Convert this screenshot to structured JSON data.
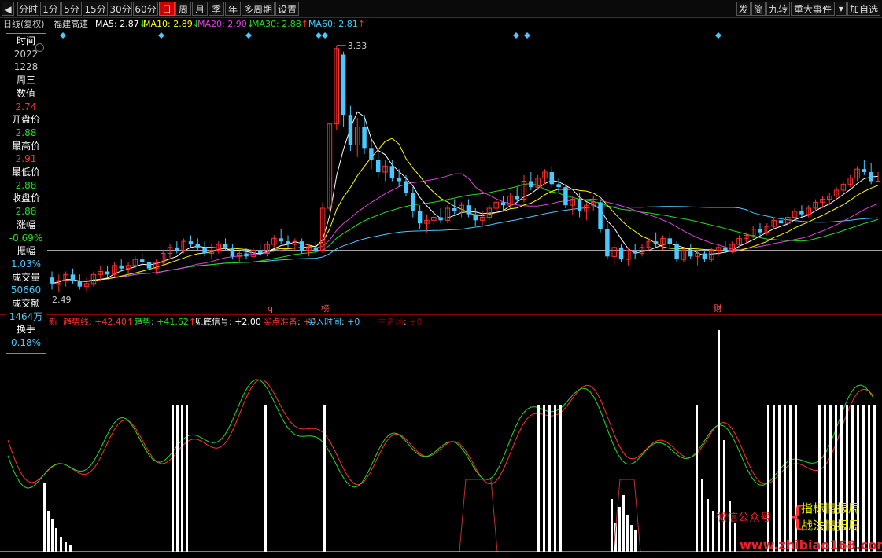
{
  "toolbar": {
    "tabs": [
      "分时",
      "1分",
      "5分",
      "15分",
      "30分",
      "60分",
      "日",
      "周",
      "月",
      "季",
      "年",
      "多周期",
      "设置"
    ],
    "active_tab": "日",
    "right_buttons": [
      "发",
      "简",
      "九转",
      "重大事件",
      "加自选"
    ]
  },
  "info": {
    "period_label": "日线(复权)",
    "stock_name": "福建高速",
    "ma": [
      {
        "label": "MA5: 2.87",
        "arrow": "↓",
        "color": "#ffffff"
      },
      {
        "label": "MA10: 2.89",
        "arrow": "↓",
        "color": "#ffff00"
      },
      {
        "label": "MA20: 2.90",
        "arrow": "↓",
        "color": "#e040e0"
      },
      {
        "label": "MA30: 2.88",
        "arrow": "↑",
        "color": "#22dd22"
      },
      {
        "label": "MA60: 2.81",
        "arrow": "↑",
        "color": "#4ac8ff"
      }
    ]
  },
  "data_panel": [
    {
      "text": "时间",
      "color": "#ffffff"
    },
    {
      "text": "2022",
      "color": "#cccccc"
    },
    {
      "text": "1228",
      "color": "#cccccc"
    },
    {
      "text": "周三",
      "color": "#ffffff"
    },
    {
      "text": "数值",
      "color": "#ffffff"
    },
    {
      "text": "2.74",
      "color": "#ff3030"
    },
    {
      "text": "开盘价",
      "color": "#ffffff"
    },
    {
      "text": "2.88",
      "color": "#22dd22"
    },
    {
      "text": "最高价",
      "color": "#ffffff"
    },
    {
      "text": "2.91",
      "color": "#ff3030"
    },
    {
      "text": "最低价",
      "color": "#ffffff"
    },
    {
      "text": "2.88",
      "color": "#22dd22"
    },
    {
      "text": "收盘价",
      "color": "#ffffff"
    },
    {
      "text": "2.88",
      "color": "#22dd22"
    },
    {
      "text": "涨幅",
      "color": "#ffffff"
    },
    {
      "text": "-0.69%",
      "color": "#22dd22"
    },
    {
      "text": "振幅",
      "color": "#ffffff"
    },
    {
      "text": "1.03%",
      "color": "#4ac8ff"
    },
    {
      "text": "成交量",
      "color": "#ffffff"
    },
    {
      "text": "50660",
      "color": "#4ac8ff"
    },
    {
      "text": "成交额",
      "color": "#ffffff"
    },
    {
      "text": "1464万",
      "color": "#4ac8ff"
    },
    {
      "text": "换手",
      "color": "#ffffff"
    },
    {
      "text": "0.18%",
      "color": "#4ac8ff"
    }
  ],
  "indicator": {
    "name": "新",
    "items": [
      {
        "label": "趋势线",
        "value": "+42.40",
        "arrow": "↑",
        "color": "#ff3030"
      },
      {
        "label": "趋势",
        "value": "+41.62",
        "arrow": "↑",
        "color": "#22dd22"
      },
      {
        "label": "见底信号",
        "value": "+2.00",
        "arrow": "",
        "color": "#ffffff"
      },
      {
        "label": "买点准备",
        "value": "+0",
        "arrow": "",
        "color": "#ff3030"
      },
      {
        "label": "买入时间",
        "value": "+0",
        "arrow": "",
        "color": "#4ac8ff"
      },
      {
        "label": "主进场",
        "value": "+0",
        "arrow": "",
        "color": "#8b0000"
      }
    ]
  },
  "watermark": {
    "wechat": "微信公众号",
    "brace": "{",
    "line1": "指标情报局",
    "line2": "战法情报局",
    "url": "www.zhibiao168.com"
  },
  "chart_data": {
    "type": "candlestick",
    "price_high_label": "3.33",
    "price_low_label": "2.49",
    "reference_price": 2.65,
    "event_markers": [
      "q",
      "榜",
      "财"
    ],
    "colors": {
      "up": "#ff3030",
      "down": "#4ac8ff",
      "ma5": "#ffffff",
      "ma10": "#ffff00",
      "ma20": "#e040e0",
      "ma30": "#22dd22",
      "ma60": "#4ac8ff"
    },
    "candles": [
      {
        "o": 2.56,
        "h": 2.58,
        "l": 2.52,
        "c": 2.54
      },
      {
        "o": 2.54,
        "h": 2.57,
        "l": 2.51,
        "c": 2.55
      },
      {
        "o": 2.55,
        "h": 2.58,
        "l": 2.53,
        "c": 2.57
      },
      {
        "o": 2.57,
        "h": 2.59,
        "l": 2.54,
        "c": 2.55
      },
      {
        "o": 2.55,
        "h": 2.57,
        "l": 2.52,
        "c": 2.53
      },
      {
        "o": 2.53,
        "h": 2.56,
        "l": 2.51,
        "c": 2.54
      },
      {
        "o": 2.54,
        "h": 2.58,
        "l": 2.53,
        "c": 2.57
      },
      {
        "o": 2.57,
        "h": 2.6,
        "l": 2.55,
        "c": 2.58
      },
      {
        "o": 2.58,
        "h": 2.6,
        "l": 2.56,
        "c": 2.57
      },
      {
        "o": 2.57,
        "h": 2.61,
        "l": 2.56,
        "c": 2.6
      },
      {
        "o": 2.6,
        "h": 2.62,
        "l": 2.58,
        "c": 2.59
      },
      {
        "o": 2.59,
        "h": 2.61,
        "l": 2.57,
        "c": 2.6
      },
      {
        "o": 2.6,
        "h": 2.63,
        "l": 2.59,
        "c": 2.62
      },
      {
        "o": 2.62,
        "h": 2.64,
        "l": 2.6,
        "c": 2.61
      },
      {
        "o": 2.61,
        "h": 2.63,
        "l": 2.58,
        "c": 2.59
      },
      {
        "o": 2.59,
        "h": 2.62,
        "l": 2.57,
        "c": 2.61
      },
      {
        "o": 2.61,
        "h": 2.65,
        "l": 2.6,
        "c": 2.64
      },
      {
        "o": 2.64,
        "h": 2.67,
        "l": 2.62,
        "c": 2.66
      },
      {
        "o": 2.66,
        "h": 2.68,
        "l": 2.64,
        "c": 2.65
      },
      {
        "o": 2.65,
        "h": 2.69,
        "l": 2.64,
        "c": 2.68
      },
      {
        "o": 2.68,
        "h": 2.7,
        "l": 2.66,
        "c": 2.67
      },
      {
        "o": 2.67,
        "h": 2.69,
        "l": 2.65,
        "c": 2.66
      },
      {
        "o": 2.66,
        "h": 2.68,
        "l": 2.63,
        "c": 2.64
      },
      {
        "o": 2.64,
        "h": 2.67,
        "l": 2.62,
        "c": 2.65
      },
      {
        "o": 2.65,
        "h": 2.68,
        "l": 2.64,
        "c": 2.67
      },
      {
        "o": 2.67,
        "h": 2.69,
        "l": 2.65,
        "c": 2.66
      },
      {
        "o": 2.66,
        "h": 2.67,
        "l": 2.62,
        "c": 2.63
      },
      {
        "o": 2.63,
        "h": 2.65,
        "l": 2.61,
        "c": 2.64
      },
      {
        "o": 2.64,
        "h": 2.66,
        "l": 2.62,
        "c": 2.63
      },
      {
        "o": 2.63,
        "h": 2.66,
        "l": 2.62,
        "c": 2.65
      },
      {
        "o": 2.65,
        "h": 2.67,
        "l": 2.63,
        "c": 2.64
      },
      {
        "o": 2.64,
        "h": 2.68,
        "l": 2.63,
        "c": 2.67
      },
      {
        "o": 2.67,
        "h": 2.7,
        "l": 2.66,
        "c": 2.69
      },
      {
        "o": 2.69,
        "h": 2.72,
        "l": 2.67,
        "c": 2.68
      },
      {
        "o": 2.68,
        "h": 2.7,
        "l": 2.66,
        "c": 2.67
      },
      {
        "o": 2.67,
        "h": 2.69,
        "l": 2.65,
        "c": 2.68
      },
      {
        "o": 2.68,
        "h": 2.69,
        "l": 2.64,
        "c": 2.65
      },
      {
        "o": 2.65,
        "h": 2.67,
        "l": 2.63,
        "c": 2.66
      },
      {
        "o": 2.66,
        "h": 2.68,
        "l": 2.64,
        "c": 2.65
      },
      {
        "o": 2.65,
        "h": 2.81,
        "l": 2.64,
        "c": 2.79
      },
      {
        "o": 2.79,
        "h": 3.07,
        "l": 2.78,
        "c": 3.07
      },
      {
        "o": 3.07,
        "h": 3.33,
        "l": 3.05,
        "c": 3.32
      },
      {
        "o": 3.3,
        "h": 3.31,
        "l": 3.06,
        "c": 3.1
      },
      {
        "o": 3.1,
        "h": 3.13,
        "l": 2.98,
        "c": 3.0
      },
      {
        "o": 3.0,
        "h": 3.09,
        "l": 2.96,
        "c": 3.06
      },
      {
        "o": 3.06,
        "h": 3.1,
        "l": 2.97,
        "c": 2.99
      },
      {
        "o": 2.99,
        "h": 3.02,
        "l": 2.92,
        "c": 2.95
      },
      {
        "o": 2.95,
        "h": 2.98,
        "l": 2.89,
        "c": 2.91
      },
      {
        "o": 2.91,
        "h": 2.95,
        "l": 2.88,
        "c": 2.93
      },
      {
        "o": 2.93,
        "h": 2.95,
        "l": 2.88,
        "c": 2.89
      },
      {
        "o": 2.89,
        "h": 2.92,
        "l": 2.86,
        "c": 2.88
      },
      {
        "o": 2.88,
        "h": 2.9,
        "l": 2.83,
        "c": 2.84
      },
      {
        "o": 2.84,
        "h": 2.86,
        "l": 2.76,
        "c": 2.78
      },
      {
        "o": 2.78,
        "h": 2.8,
        "l": 2.72,
        "c": 2.74
      },
      {
        "o": 2.74,
        "h": 2.77,
        "l": 2.71,
        "c": 2.75
      },
      {
        "o": 2.75,
        "h": 2.78,
        "l": 2.73,
        "c": 2.76
      },
      {
        "o": 2.76,
        "h": 2.79,
        "l": 2.74,
        "c": 2.75
      },
      {
        "o": 2.75,
        "h": 2.8,
        "l": 2.74,
        "c": 2.79
      },
      {
        "o": 2.79,
        "h": 2.82,
        "l": 2.77,
        "c": 2.78
      },
      {
        "o": 2.78,
        "h": 2.81,
        "l": 2.76,
        "c": 2.8
      },
      {
        "o": 2.8,
        "h": 2.82,
        "l": 2.76,
        "c": 2.77
      },
      {
        "o": 2.77,
        "h": 2.79,
        "l": 2.73,
        "c": 2.75
      },
      {
        "o": 2.75,
        "h": 2.78,
        "l": 2.73,
        "c": 2.76
      },
      {
        "o": 2.76,
        "h": 2.8,
        "l": 2.75,
        "c": 2.79
      },
      {
        "o": 2.79,
        "h": 2.82,
        "l": 2.77,
        "c": 2.81
      },
      {
        "o": 2.81,
        "h": 2.83,
        "l": 2.78,
        "c": 2.8
      },
      {
        "o": 2.8,
        "h": 2.84,
        "l": 2.79,
        "c": 2.83
      },
      {
        "o": 2.83,
        "h": 2.86,
        "l": 2.81,
        "c": 2.82
      },
      {
        "o": 2.82,
        "h": 2.9,
        "l": 2.81,
        "c": 2.88
      },
      {
        "o": 2.88,
        "h": 2.91,
        "l": 2.85,
        "c": 2.86
      },
      {
        "o": 2.86,
        "h": 2.9,
        "l": 2.85,
        "c": 2.89
      },
      {
        "o": 2.89,
        "h": 2.92,
        "l": 2.87,
        "c": 2.91
      },
      {
        "o": 2.91,
        "h": 2.93,
        "l": 2.86,
        "c": 2.87
      },
      {
        "o": 2.87,
        "h": 2.89,
        "l": 2.84,
        "c": 2.86
      },
      {
        "o": 2.86,
        "h": 2.87,
        "l": 2.79,
        "c": 2.8
      },
      {
        "o": 2.8,
        "h": 2.83,
        "l": 2.77,
        "c": 2.82
      },
      {
        "o": 2.82,
        "h": 2.84,
        "l": 2.76,
        "c": 2.78
      },
      {
        "o": 2.78,
        "h": 2.81,
        "l": 2.75,
        "c": 2.8
      },
      {
        "o": 2.8,
        "h": 2.83,
        "l": 2.78,
        "c": 2.81
      },
      {
        "o": 2.81,
        "h": 2.82,
        "l": 2.71,
        "c": 2.72
      },
      {
        "o": 2.72,
        "h": 2.74,
        "l": 2.62,
        "c": 2.63
      },
      {
        "o": 2.63,
        "h": 2.67,
        "l": 2.6,
        "c": 2.66
      },
      {
        "o": 2.66,
        "h": 2.67,
        "l": 2.61,
        "c": 2.62
      },
      {
        "o": 2.62,
        "h": 2.66,
        "l": 2.6,
        "c": 2.65
      },
      {
        "o": 2.65,
        "h": 2.67,
        "l": 2.62,
        "c": 2.64
      },
      {
        "o": 2.64,
        "h": 2.67,
        "l": 2.63,
        "c": 2.66
      },
      {
        "o": 2.66,
        "h": 2.69,
        "l": 2.65,
        "c": 2.68
      },
      {
        "o": 2.68,
        "h": 2.71,
        "l": 2.66,
        "c": 2.67
      },
      {
        "o": 2.67,
        "h": 2.7,
        "l": 2.65,
        "c": 2.69
      },
      {
        "o": 2.69,
        "h": 2.71,
        "l": 2.66,
        "c": 2.67
      },
      {
        "o": 2.67,
        "h": 2.68,
        "l": 2.61,
        "c": 2.62
      },
      {
        "o": 2.62,
        "h": 2.66,
        "l": 2.61,
        "c": 2.65
      },
      {
        "o": 2.65,
        "h": 2.67,
        "l": 2.62,
        "c": 2.63
      },
      {
        "o": 2.63,
        "h": 2.65,
        "l": 2.6,
        "c": 2.64
      },
      {
        "o": 2.64,
        "h": 2.65,
        "l": 2.61,
        "c": 2.62
      },
      {
        "o": 2.62,
        "h": 2.66,
        "l": 2.61,
        "c": 2.65
      },
      {
        "o": 2.65,
        "h": 2.67,
        "l": 2.63,
        "c": 2.66
      },
      {
        "o": 2.66,
        "h": 2.68,
        "l": 2.64,
        "c": 2.65
      },
      {
        "o": 2.65,
        "h": 2.68,
        "l": 2.64,
        "c": 2.67
      },
      {
        "o": 2.67,
        "h": 2.7,
        "l": 2.66,
        "c": 2.69
      },
      {
        "o": 2.69,
        "h": 2.71,
        "l": 2.67,
        "c": 2.7
      },
      {
        "o": 2.7,
        "h": 2.73,
        "l": 2.69,
        "c": 2.72
      },
      {
        "o": 2.72,
        "h": 2.74,
        "l": 2.7,
        "c": 2.71
      },
      {
        "o": 2.71,
        "h": 2.74,
        "l": 2.7,
        "c": 2.73
      },
      {
        "o": 2.73,
        "h": 2.76,
        "l": 2.72,
        "c": 2.75
      },
      {
        "o": 2.75,
        "h": 2.77,
        "l": 2.73,
        "c": 2.74
      },
      {
        "o": 2.74,
        "h": 2.77,
        "l": 2.73,
        "c": 2.76
      },
      {
        "o": 2.76,
        "h": 2.79,
        "l": 2.75,
        "c": 2.78
      },
      {
        "o": 2.78,
        "h": 2.8,
        "l": 2.76,
        "c": 2.77
      },
      {
        "o": 2.77,
        "h": 2.8,
        "l": 2.76,
        "c": 2.79
      },
      {
        "o": 2.79,
        "h": 2.82,
        "l": 2.78,
        "c": 2.81
      },
      {
        "o": 2.81,
        "h": 2.83,
        "l": 2.79,
        "c": 2.82
      },
      {
        "o": 2.82,
        "h": 2.84,
        "l": 2.8,
        "c": 2.83
      },
      {
        "o": 2.83,
        "h": 2.86,
        "l": 2.82,
        "c": 2.85
      },
      {
        "o": 2.85,
        "h": 2.88,
        "l": 2.84,
        "c": 2.87
      },
      {
        "o": 2.87,
        "h": 2.9,
        "l": 2.86,
        "c": 2.89
      },
      {
        "o": 2.89,
        "h": 2.93,
        "l": 2.88,
        "c": 2.92
      },
      {
        "o": 2.92,
        "h": 2.95,
        "l": 2.9,
        "c": 2.91
      },
      {
        "o": 2.91,
        "h": 2.94,
        "l": 2.87,
        "c": 2.88
      },
      {
        "o": 2.88,
        "h": 2.91,
        "l": 2.88,
        "c": 2.88
      }
    ]
  }
}
